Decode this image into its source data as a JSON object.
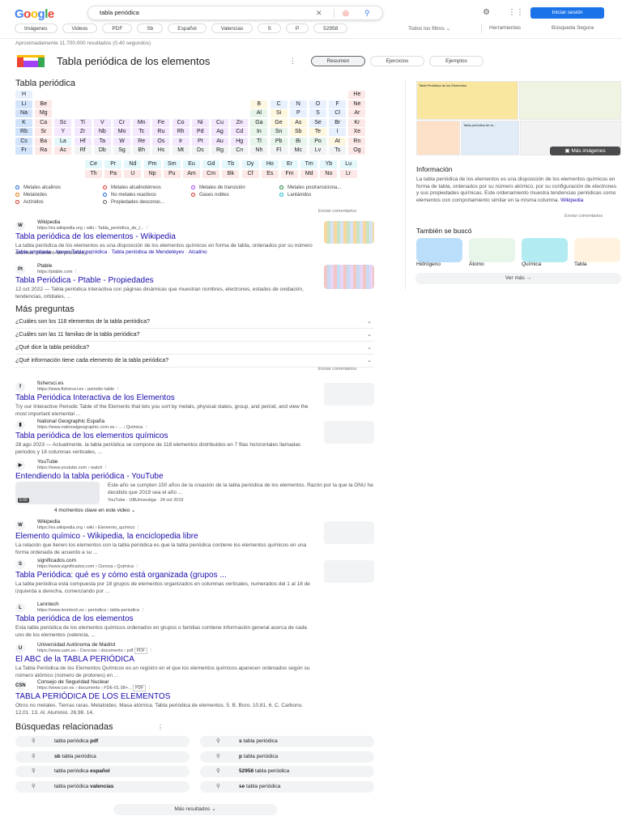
{
  "header": {
    "logo": "Google",
    "query": "tabla periódica",
    "signin": "Iniciar sesión",
    "chips": [
      "Imágenes",
      "Videos",
      "PDF",
      "Sb",
      "Español",
      "Valencias",
      "S",
      "P",
      "52958"
    ],
    "all_filters": "Todos los filtros",
    "tools": "Herramientas",
    "safe_search": "Búsqueda Segura"
  },
  "results_count": "Aproximadamente 11.700.000 resultados (0,40 segundos)",
  "knowledge": {
    "title": "Tabla periódica de los elementos",
    "tabs": [
      "Resumen",
      "Ejercicios",
      "Ejemplos"
    ],
    "section": "Tabla periódica",
    "legend": [
      {
        "label": "Metales alcalinos",
        "color": "#1967d2"
      },
      {
        "label": "Metales alcalinotérreos",
        "color": "#d93025"
      },
      {
        "label": "Metales de transición",
        "color": "#a142f4"
      },
      {
        "label": "Metales postransiciona...",
        "color": "#188038"
      },
      {
        "label": "Metaloides",
        "color": "#e37400"
      },
      {
        "label": "No metales reactivos",
        "color": "#1967d2"
      },
      {
        "label": "Gases nobles",
        "color": "#d93025"
      },
      {
        "label": "Lantánidos",
        "color": "#12b5cb"
      },
      {
        "label": "Actínidos",
        "color": "#d93025"
      },
      {
        "label": "Propiedades desconoc...",
        "color": "#5f6368"
      }
    ],
    "feedback": "Enviar comentarios"
  },
  "periodic": {
    "main": [
      [
        "H",
        "",
        "",
        "",
        "",
        "",
        "",
        "",
        "",
        "",
        "",
        "",
        "",
        "",
        "",
        "",
        "",
        "He"
      ],
      [
        "Li",
        "Be",
        "",
        "",
        "",
        "",
        "",
        "",
        "",
        "",
        "",
        "",
        "B",
        "C",
        "N",
        "O",
        "F",
        "Ne"
      ],
      [
        "Na",
        "Mg",
        "",
        "",
        "",
        "",
        "",
        "",
        "",
        "",
        "",
        "",
        "Al",
        "Si",
        "P",
        "S",
        "Cl",
        "Ar"
      ],
      [
        "K",
        "Ca",
        "Sc",
        "Ti",
        "V",
        "Cr",
        "Mn",
        "Fe",
        "Co",
        "Ni",
        "Cu",
        "Zn",
        "Ga",
        "Ge",
        "As",
        "Se",
        "Br",
        "Kr"
      ],
      [
        "Rb",
        "Sr",
        "Y",
        "Zr",
        "Nb",
        "Mo",
        "Tc",
        "Ru",
        "Rh",
        "Pd",
        "Ag",
        "Cd",
        "In",
        "Sn",
        "Sb",
        "Te",
        "I",
        "Xe"
      ],
      [
        "Cs",
        "Ba",
        "La",
        "Hf",
        "Ta",
        "W",
        "Re",
        "Os",
        "Ir",
        "Pt",
        "Au",
        "Hg",
        "Tl",
        "Pb",
        "Bi",
        "Po",
        "At",
        "Rn"
      ],
      [
        "Fr",
        "Ra",
        "Ac",
        "Rf",
        "Db",
        "Sg",
        "Bh",
        "Hs",
        "Mt",
        "Ds",
        "Rg",
        "Cn",
        "Nh",
        "Fl",
        "Mc",
        "Lv",
        "Ts",
        "Og"
      ]
    ],
    "lanthanides": [
      "Ce",
      "Pr",
      "Nd",
      "Pm",
      "Sm",
      "Eu",
      "Gd",
      "Tb",
      "Dy",
      "Ho",
      "Er",
      "Tm",
      "Yb",
      "Lu"
    ],
    "actinides": [
      "Th",
      "Pa",
      "U",
      "Np",
      "Pu",
      "Am",
      "Cm",
      "Bk",
      "Cf",
      "Es",
      "Fm",
      "Md",
      "No",
      "Lr"
    ]
  },
  "results_top": [
    {
      "source": "Wikipedia",
      "url": "https://es.wikipedia.org › wiki › Tabla_periódica_de_l...",
      "title": "Tabla periódica de los elementos - Wikipedia",
      "snippet": "La tabla periódica de los elementos es una disposición de los elementos químicos en forma de tabla, ordenados por su número atómico (número de protones), ...",
      "sublinks": [
        "Tabla ampliada",
        "Anexo:Tabla periódica",
        "Tabla periódica de Mendeléyev",
        "Alcalino"
      ],
      "fav": "W"
    },
    {
      "source": "Ptable",
      "url": "https://ptable.com",
      "title": "Tabla Periódica - Ptable - Propiedades",
      "snippet": "12 oct 2022 — Tabla periódica interactiva con páginas dinámicas que muestran nombres, electrones, estados de oxidación, tendencias, orbitales, ...",
      "fav": "Pt"
    }
  ],
  "paa": {
    "title": "Más preguntas",
    "questions": [
      "¿Cuáles son los 118 elementos de la tabla periódica?",
      "¿Cuáles son las 11 familias de la tabla periódica?",
      "¿Qué dice la tabla periódica?",
      "¿Qué información tiene cada elemento de la tabla periódica?"
    ],
    "feedback": "Enviar comentarios"
  },
  "results": [
    {
      "source": "fishersci.es",
      "url": "https://www.fishersci.es › periodic-table",
      "title": "Tabla Periódica Interactiva de los Elementos",
      "snippet": "Try our Interactive Periodic Table of the Elements that lets you sort by metals, physical states, group, and period, and view the most important elemental ...",
      "fav": "f"
    },
    {
      "source": "National Geographic España",
      "url": "https://www.nationalgeographic.com.es › ... › Química",
      "title": "Tabla periódica de los elementos químicos",
      "snippet": "28 ago 2023 — Actualmente, la tabla periódica se compone de 118 elementos distribuidos en 7 filas horizontales llamadas periodos y 18 columnas verticales, ...",
      "fav": "▮"
    },
    {
      "source": "YouTube",
      "url": "https://www.youtube.com › watch",
      "title": "Entendiendo la tabla periódica - YouTube",
      "snippet": "Este año se cumplen 150 años de la creación de la tabla periódica de los elementos. Razón por la que la ONU ha decidido que 2019 sea el año ...",
      "meta": "YouTube · UBUinvestiga · 24 oct 2019",
      "duration": "6:00",
      "moments": "4 momentos clave en este video",
      "fav": "▶"
    },
    {
      "source": "Wikipedia",
      "url": "https://es.wikipedia.org › wiki › Elemento_químico",
      "title": "Elemento químico - Wikipedia, la enciclopedia libre",
      "snippet": "La relación que tienen los elementos con la tabla periódica es que la tabla periódica contiene los elementos químicos en una forma ordenada de acuerdo a su ...",
      "fav": "W"
    },
    {
      "source": "significados.com",
      "url": "https://www.significados.com › Ciencia › Química",
      "title": "Tabla Periódica: qué es y cómo está organizada (grupos ...",
      "snippet": "La tabla periódica está compuesta por 18 grupos de elementos organizados en columnas verticales, numerados del 1 al 18 de izquierda a derecha, comenzando por ...",
      "fav": "S"
    },
    {
      "source": "Lenntech",
      "url": "https://www.lenntech.es › periodica › tabla-periodica",
      "title": "Tabla periódica de los elementos",
      "snippet": "Esta tabla periódica de los elementos químicos ordenados en grupos o familias contiene información general acerca de cada uno de los elementos (valencia, ...",
      "fav": "L"
    },
    {
      "source": "Universidad Autónoma de Madrid",
      "url": "https://www.uam.es › Ciencias › documento › pdf",
      "tag": "PDF",
      "title": "El ABC de la TABLA PERIÓDICA",
      "snippet": "La Tabla Periódica de los Elementos Químicos es un registro en el que los elementos químicos aparecen ordenados según su número atómico (número de protones) en ...",
      "fav": "U"
    },
    {
      "source": "Consejo de Seguridad Nuclear",
      "url": "https://www.csn.es › documents › FDE-01.08+...",
      "tag": "PDF",
      "title": "TABLA PERIÓDICA DE LOS ELEMENTOS",
      "snippet": "Otros no metales. Tierras raras. Metaloides. Masa atómica. Tabla periódica de elementos. 5. B. Boro. 10,81. 6. C. Carbono. 12,01. 13. Al. Aluminio. 26,98. 14.",
      "fav": "CSN"
    }
  ],
  "related": {
    "title": "Búsquedas relacionadas",
    "items": [
      {
        "pre": "tabla periódica ",
        "bold": "pdf"
      },
      {
        "pre": "",
        "bold": "s",
        "post": " tabla periódica"
      },
      {
        "pre": "",
        "bold": "sb",
        "post": " tabla periódica"
      },
      {
        "pre": "",
        "bold": "p",
        "post": " tabla periódica"
      },
      {
        "pre": "tabla periódica ",
        "bold": "español"
      },
      {
        "pre": "",
        "bold": "52958",
        "post": " tabla periódica"
      },
      {
        "pre": "tabla periódica ",
        "bold": "valencias"
      },
      {
        "pre": "",
        "bold": "se",
        "post": " tabla periódica"
      }
    ],
    "more": "Más resultados"
  },
  "right": {
    "more_images": "Más imágenes",
    "info_title": "Información",
    "info_text": "La tabla periódica de los elementos es una disposición de los elementos químicos en forma de tabla, ordenados por su número atómico,  por su configuración de electrones y sus propiedades químicas. Este ordenamiento muestra tendencias periódicas como elementos con comportamiento similar en la misma columna.",
    "info_link": "Wikipedia",
    "feedback": "Enviar comentarios",
    "also_title": "También se buscó",
    "also": [
      "Hidrógeno",
      "Átomo",
      "Química",
      "Tabla"
    ],
    "see_more": "Ver más",
    "image_titles": [
      "Tabla Periódica de los Elementos",
      "Tabla periódica de la..."
    ]
  },
  "colors": {
    "alkali": "#d2e3fc",
    "alkaline": "#fce8e6",
    "transition": "#f3e8fd",
    "post": "#e6f4ea",
    "metalloid": "#fef7e0",
    "nonmetal": "#e8f0fe",
    "noble": "#fce8e6",
    "lanth": "#e4f7fb",
    "act": "#fce8e6",
    "unknown": "#f1f3f4",
    "link": "#1a0dab",
    "signin": "#1a73e8"
  }
}
